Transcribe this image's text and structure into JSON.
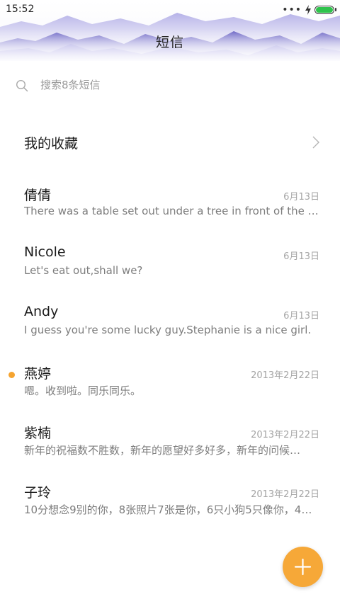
{
  "status_bar": {
    "time": "15:52",
    "more_dots": "•••",
    "battery_icon": "battery-full-icon",
    "charging_icon": "charging-bolt-icon"
  },
  "header": {
    "title": "短信"
  },
  "search": {
    "placeholder": "搜索8条短信",
    "icon": "search-icon"
  },
  "favorites": {
    "label": "我的收藏",
    "icon": "chevron-right-icon"
  },
  "conversations": [
    {
      "name": "倩倩",
      "date": "6月13日",
      "preview": "There was a table set out under a tree in front of the ho…",
      "unread": false
    },
    {
      "name": "Nicole",
      "date": "6月13日",
      "preview": "Let's eat out,shall we?",
      "unread": false
    },
    {
      "name": "Andy",
      "date": "6月13日",
      "preview": "I guess you're some lucky guy.Stephanie is a nice girl.",
      "unread": false
    },
    {
      "name": "燕婷",
      "date": "2013年2月22日",
      "preview": "嗯。收到啦。同乐同乐。",
      "unread": true
    },
    {
      "name": "紫楠",
      "date": "2013年2月22日",
      "preview": "新年的祝福数不胜数，新年的愿望好多好多，新年的问候…",
      "unread": false
    },
    {
      "name": "子玲",
      "date": "2013年2月22日",
      "preview": "10分想念9别的你，8张照片7张是你，6只小狗5只像你，4…",
      "unread": false
    }
  ],
  "fab": {
    "icon": "plus-icon"
  },
  "colors": {
    "accent": "#f6a838",
    "unread_dot": "#f5a431",
    "battery": "#2fc34c",
    "mountains": "#6b63c9"
  }
}
